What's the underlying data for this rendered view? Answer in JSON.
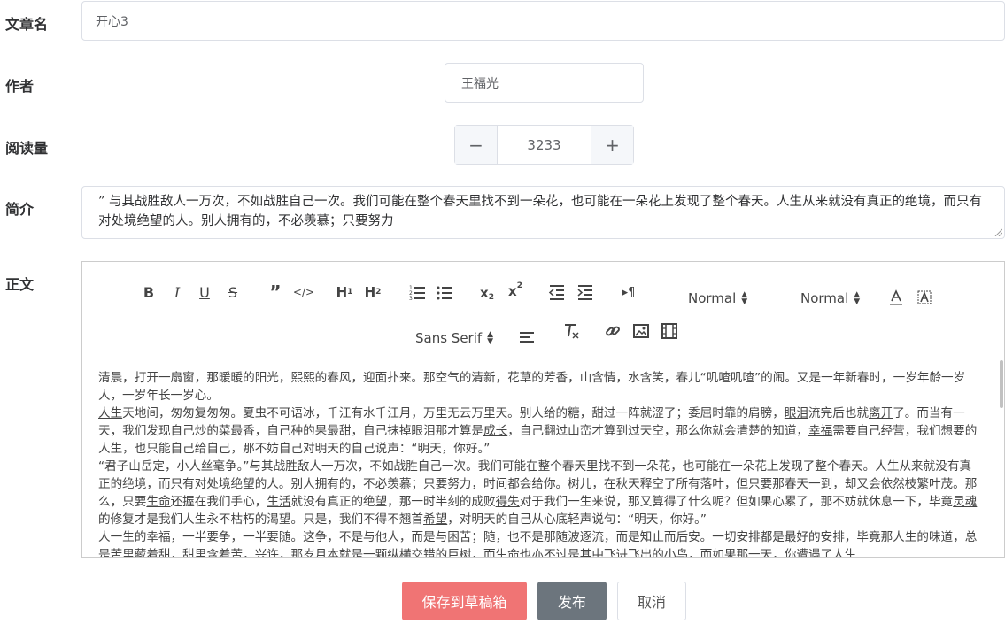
{
  "form": {
    "title_label": "文章名",
    "title_value": "开心3",
    "author_label": "作者",
    "author_value": "王福光",
    "views_label": "阅读量",
    "views_value": "3233",
    "minus_symbol": "−",
    "plus_symbol": "+",
    "summary_label": "简介",
    "summary_value": "” 与其战胜敌人一万次，不如战胜自己一次。我们可能在整个春天里找不到一朵花，也可能在一朵花上发现了整个春天。人生从来就没有真正的绝境，而只有对处境绝望的人。别人拥有的，不必羡慕；只要努力",
    "body_label": "正文"
  },
  "toolbar": {
    "header_picker": "Normal",
    "size_picker": "Normal",
    "font_picker": "Sans Serif"
  },
  "editor": {
    "paragraphs": [
      [
        {
          "t": "清晨，打开一扇窗，那暖暖的阳光，熙熙的春风，迎面扑来。那空气的清新，花草的芳香，山含情，水含笑，春儿“叽喳叽喳”的闹。又是一年新春时，一岁年龄一岁人，一岁年长一岁心。"
        }
      ],
      [
        {
          "t": "人生",
          "u": true
        },
        {
          "t": "天地间，匆匆复匆匆。夏虫不可语冰，千江有水千江月，万里无云万里天。别人给的糖，甜过一阵就涩了；委屈时靠的肩膀，"
        },
        {
          "t": "眼泪",
          "u": true
        },
        {
          "t": "流完后也就"
        },
        {
          "t": "离开",
          "u": true
        },
        {
          "t": "了。而当有一天，我们发现自己炒的菜最香，自己种的果最甜，自己抹掉眼泪那才算是"
        },
        {
          "t": "成长",
          "u": true
        },
        {
          "t": "，自己翻过山峦才算到过天空，那么你就会清楚的知道，"
        },
        {
          "t": "幸福",
          "u": true
        },
        {
          "t": "需要自己经营，我们想要的人生，也只能自己给自己，那不妨自己对明天的自己说声：“明天，你好。”"
        }
      ],
      [
        {
          "t": "“君子山岳定，小人丝毫争。”与其战胜敌人一万次，不如战胜自己一次。我们可能在整个春天里找不到一朵花，也可能在一朵花上发现了整个春天。人生从来就没有真正的绝境，而只有对处境"
        },
        {
          "t": "绝望",
          "u": true
        },
        {
          "t": "的人。别人"
        },
        {
          "t": "拥有",
          "u": true
        },
        {
          "t": "的，不必羡慕；只要"
        },
        {
          "t": "努力",
          "u": true
        },
        {
          "t": "，"
        },
        {
          "t": "时间",
          "u": true
        },
        {
          "t": "都会给你。树儿，在秋天释空了所有落叶，但只要那春天一到，却又会依然枝繁叶茂。那么，只要"
        },
        {
          "t": "生命",
          "u": true
        },
        {
          "t": "还握在我们手心，"
        },
        {
          "t": "生活",
          "u": true
        },
        {
          "t": "就没有真正的绝望，那一时半刻的成败"
        },
        {
          "t": "得失",
          "u": true
        },
        {
          "t": "对于我们一生来说，那又算得了什么呢？但如果心累了，那不妨就休息一下，毕竟"
        },
        {
          "t": "灵魂",
          "u": true
        },
        {
          "t": "的修复才是我们人生永不枯朽的渴望。只是，我们不得不翘首"
        },
        {
          "t": "希望",
          "u": true
        },
        {
          "t": "，对明天的自己从心底轻声说句：“明天，你好。”"
        }
      ],
      [
        {
          "t": "人一生的幸福，一半要争，一半要随。这争，不是与他人，而是与困苦；随，也不是那随波逐流，而是知止而后安。一切安排都是最好的安排，毕竟那人生的味道，总是苦里藏着甜，甜里含着苦，兴许，那岁月本就是一颗纵横交错的巨树，而生命也亦不过是其中飞进飞出的小鸟，而如果那一天，你遭遇了人生"
        }
      ]
    ]
  },
  "actions": {
    "draft_label": "保存到草稿箱",
    "publish_label": "发布",
    "cancel_label": "取消"
  }
}
